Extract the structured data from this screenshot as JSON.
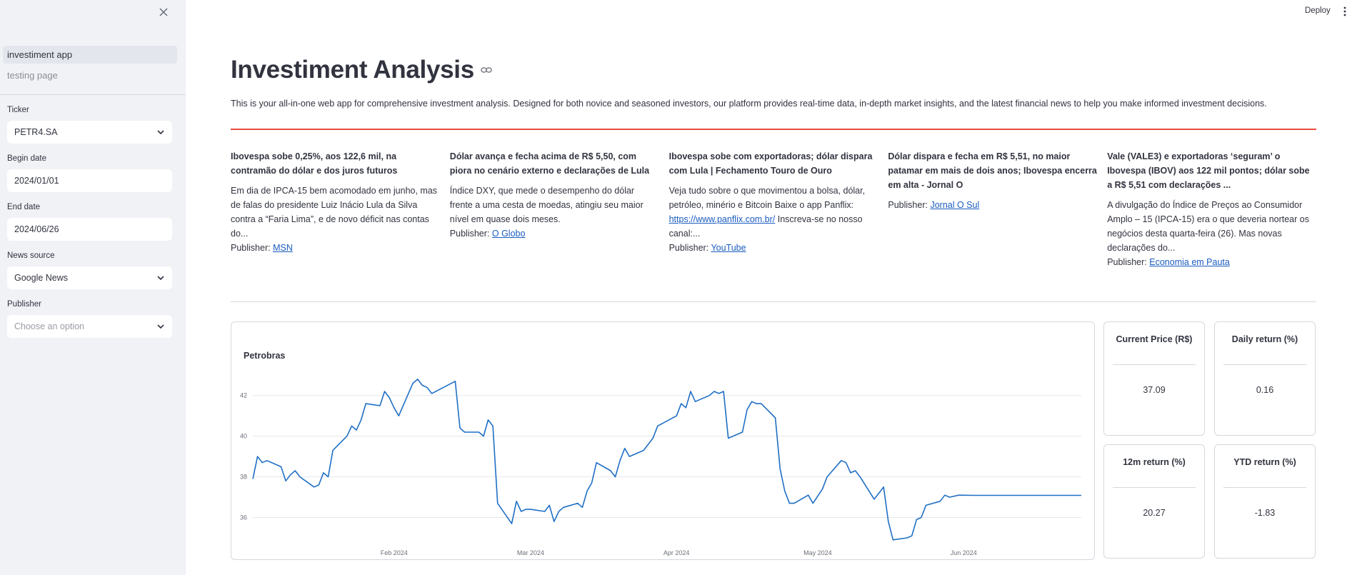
{
  "sidebar": {
    "nav": [
      {
        "label": "investiment app",
        "active": true
      },
      {
        "label": "testing page",
        "active": false
      }
    ],
    "ticker": {
      "label": "Ticker",
      "value": "PETR4.SA"
    },
    "begin_date": {
      "label": "Begin date",
      "value": "2024/01/01"
    },
    "end_date": {
      "label": "End date",
      "value": "2024/06/26"
    },
    "news_source": {
      "label": "News source",
      "value": "Google News"
    },
    "publisher": {
      "label": "Publisher",
      "placeholder": "Choose an option"
    }
  },
  "header": {
    "deploy_label": "Deploy"
  },
  "page": {
    "title": "Investiment Analysis",
    "intro": "This is your all-in-one web app for comprehensive investment analysis. Designed for both novice and seasoned investors, our platform provides real-time data, in-depth market insights, and the latest financial news to help you make informed investment decisions."
  },
  "news": [
    {
      "title": "Ibovespa sobe 0,25%, aos 122,6 mil, na contramão do dólar e dos juros futuros",
      "desc": "Em dia de IPCA-15 bem acomodado em junho, mas de falas do presidente Luiz Inácio Lula da Silva contra a “Faria Lima”, e de novo déficit nas contas do...",
      "publisher_label": "Publisher:",
      "publisher": "MSN"
    },
    {
      "title": "Dólar avança e fecha acima de R$ 5,50, com piora no cenário externo e declarações de Lula",
      "desc": "Índice DXY, que mede o desempenho do dólar frente a uma cesta de moedas, atingiu seu maior nível em quase dois meses.",
      "publisher_label": "Publisher:",
      "publisher": "O Globo"
    },
    {
      "title": "Ibovespa sobe com exportadoras; dólar dispara com Lula | Fechamento Touro de Ouro",
      "desc_pre": "Veja tudo sobre o que movimentou a bolsa, dólar, petróleo, minério e Bitcoin Baixe o app Panflix: ",
      "desc_link": "https://www.panflix.com.br/",
      "desc_post": " Inscreva-se no nosso canal:...",
      "publisher_label": "Publisher:",
      "publisher": "YouTube"
    },
    {
      "title": "Dólar dispara e fecha em R$ 5,51, no maior patamar em mais de dois anos; Ibovespa encerra em alta - Jornal O",
      "desc": "",
      "publisher_label": "Publisher:",
      "publisher": "Jornal O Sul"
    },
    {
      "title": "Vale (VALE3) e exportadoras ‘seguram’ o Ibovespa (IBOV) aos 122 mil pontos; dólar sobe a R$ 5,51 com declarações ...",
      "desc": "A divulgação do Índice de Preços ao Consumidor Amplo – 15 (IPCA-15) era o que deveria nortear os negócios desta quarta-feira (26). Mas novas declarações do...",
      "publisher_label": "Publisher:",
      "publisher": "Economia em Pauta"
    }
  ],
  "metrics": [
    {
      "label": "Current Price (R$)",
      "value": "37.09"
    },
    {
      "label": "Daily return (%)",
      "value": "0.16"
    },
    {
      "label": "12m return (%)",
      "value": "20.27"
    },
    {
      "label": "YTD return (%)",
      "value": "-1.83"
    }
  ],
  "chart_data": {
    "type": "line",
    "title": "Petrobras",
    "xlabel": "",
    "ylabel": "",
    "x_range": [
      "2024-01-02",
      "2024-06-26"
    ],
    "ylim": [
      35,
      43.5
    ],
    "y_ticks": [
      36,
      38,
      40,
      42
    ],
    "x_ticks": [
      {
        "date": "2024-02-01",
        "label": "Feb 2024"
      },
      {
        "date": "2024-03-01",
        "label": "Mar 2024"
      },
      {
        "date": "2024-04-01",
        "label": "Apr 2024"
      },
      {
        "date": "2024-05-01",
        "label": "May 2024"
      },
      {
        "date": "2024-06-01",
        "label": "Jun 2024"
      }
    ],
    "grid": "horizontal",
    "color": "#1f6fc5",
    "series": [
      {
        "x": [
          "2024-01-02",
          "2024-01-03",
          "2024-01-04",
          "2024-01-05",
          "2024-01-08",
          "2024-01-09",
          "2024-01-10",
          "2024-01-11",
          "2024-01-12",
          "2024-01-15",
          "2024-01-16",
          "2024-01-17",
          "2024-01-18",
          "2024-01-19",
          "2024-01-22",
          "2024-01-23",
          "2024-01-24",
          "2024-01-25",
          "2024-01-26",
          "2024-01-29",
          "2024-01-30",
          "2024-01-31",
          "2024-02-01",
          "2024-02-02",
          "2024-02-05",
          "2024-02-06",
          "2024-02-07",
          "2024-02-08",
          "2024-02-09",
          "2024-02-14",
          "2024-02-15",
          "2024-02-16",
          "2024-02-19",
          "2024-02-20",
          "2024-02-21",
          "2024-02-22",
          "2024-02-23",
          "2024-02-26",
          "2024-02-27",
          "2024-02-28",
          "2024-02-29",
          "2024-03-01",
          "2024-03-04",
          "2024-03-05",
          "2024-03-06",
          "2024-03-07",
          "2024-03-08",
          "2024-03-11",
          "2024-03-12",
          "2024-03-13",
          "2024-03-14",
          "2024-03-15",
          "2024-03-18",
          "2024-03-19",
          "2024-03-20",
          "2024-03-21",
          "2024-03-22",
          "2024-03-25",
          "2024-03-26",
          "2024-03-27",
          "2024-03-28",
          "2024-04-01",
          "2024-04-02",
          "2024-04-03",
          "2024-04-04",
          "2024-04-05",
          "2024-04-08",
          "2024-04-09",
          "2024-04-10",
          "2024-04-11",
          "2024-04-12",
          "2024-04-15",
          "2024-04-16",
          "2024-04-17",
          "2024-04-18",
          "2024-04-19",
          "2024-04-22",
          "2024-04-23",
          "2024-04-24",
          "2024-04-25",
          "2024-04-26",
          "2024-04-29",
          "2024-04-30",
          "2024-05-02",
          "2024-05-03",
          "2024-05-06",
          "2024-05-07",
          "2024-05-08",
          "2024-05-09",
          "2024-05-10",
          "2024-05-13",
          "2024-05-14",
          "2024-05-15",
          "2024-05-16",
          "2024-05-17",
          "2024-05-20",
          "2024-05-21",
          "2024-05-22",
          "2024-05-23",
          "2024-05-24",
          "2024-05-27",
          "2024-05-28",
          "2024-05-29",
          "2024-05-31",
          "2024-06-03",
          "2024-06-04",
          "2024-06-05",
          "2024-06-06",
          "2024-06-07",
          "2024-06-10",
          "2024-06-11",
          "2024-06-12",
          "2024-06-13",
          "2024-06-14",
          "2024-06-17",
          "2024-06-18",
          "2024-06-19",
          "2024-06-20",
          "2024-06-21",
          "2024-06-24",
          "2024-06-25",
          "2024-06-26"
        ],
        "y": [
          37.9,
          39.0,
          38.7,
          38.8,
          38.5,
          37.8,
          38.1,
          38.3,
          38.0,
          37.5,
          37.6,
          38.2,
          38.0,
          39.3,
          40.0,
          40.5,
          40.3,
          40.8,
          41.6,
          41.5,
          42.2,
          41.9,
          41.4,
          41.0,
          42.6,
          42.8,
          42.5,
          42.4,
          42.1,
          42.7,
          40.4,
          40.2,
          40.2,
          40.0,
          40.8,
          40.5,
          36.7,
          35.7,
          36.8,
          36.3,
          36.4,
          36.4,
          36.3,
          36.6,
          35.8,
          36.3,
          36.5,
          36.7,
          36.5,
          37.3,
          37.7,
          38.7,
          38.3,
          38.0,
          38.8,
          39.4,
          39.0,
          39.3,
          39.6,
          39.9,
          40.5,
          41.0,
          41.6,
          41.4,
          42.2,
          41.7,
          42.0,
          42.2,
          42.1,
          42.2,
          39.9,
          40.2,
          41.3,
          41.7,
          41.6,
          41.6,
          40.9,
          38.4,
          37.3,
          36.7,
          36.7,
          37.1,
          36.7,
          37.4,
          38.0,
          38.8,
          38.7,
          38.2,
          38.3,
          38.0,
          36.9,
          37.2,
          37.5,
          35.8,
          34.9,
          35.0,
          35.1,
          35.9,
          36.0,
          36.6,
          36.8,
          37.1,
          37.0,
          37.1,
          37.09,
          37.09,
          37.09,
          37.09,
          37.09,
          37.09,
          37.09,
          37.09,
          37.09,
          37.09,
          37.09,
          37.09,
          37.09,
          37.09,
          37.09,
          37.09,
          37.09,
          37.09
        ]
      }
    ]
  }
}
